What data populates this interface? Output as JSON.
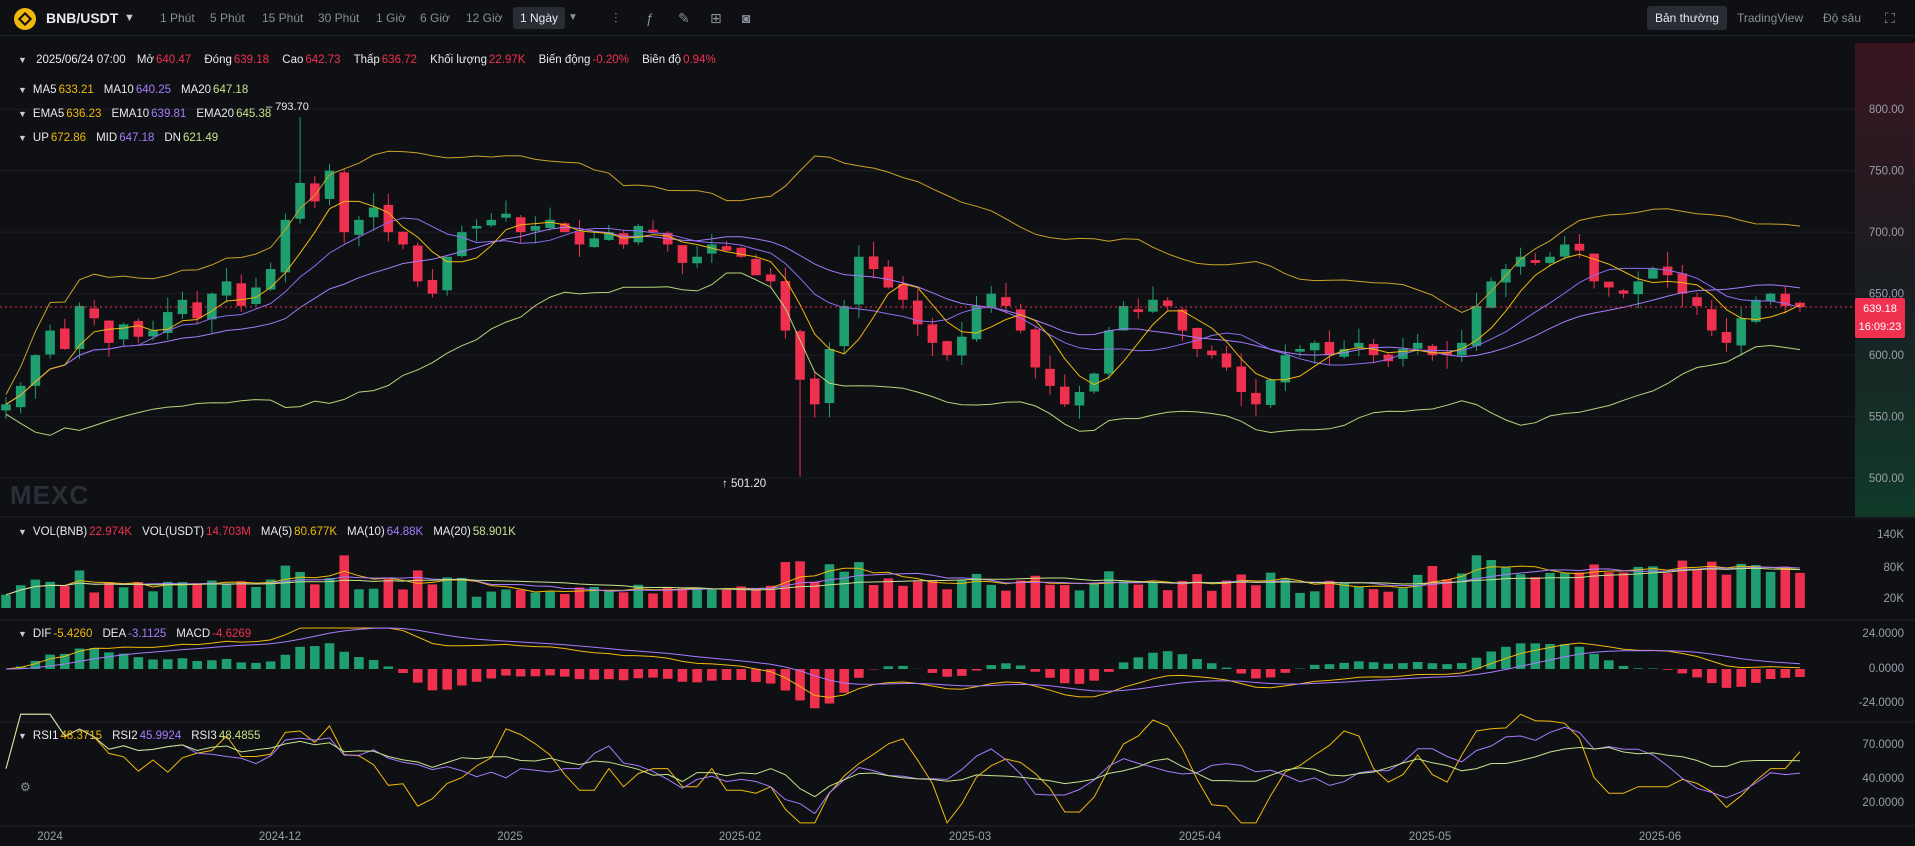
{
  "app": {
    "pair": "BNB/USDT",
    "intervals": [
      "1 Phút",
      "5 Phút",
      "15 Phút",
      "30 Phút",
      "1 Giờ",
      "6 Giờ",
      "12 Giờ",
      "1 Ngày"
    ],
    "active_interval": "1 Ngày",
    "view_modes": [
      "Bản thường",
      "TradingView",
      "Độ sâu"
    ],
    "active_view": "Bản thường",
    "watermark": "MEXC"
  },
  "ohlc": {
    "date": "2025/06/24 07:00",
    "open_label": "Mở",
    "open": "640.47",
    "close_label": "Đóng",
    "close": "639.18",
    "high_label": "Cao",
    "high": "642.73",
    "low_label": "Thấp",
    "low": "636.72",
    "volume_label": "Khối lượng",
    "volume": "22.97K",
    "change_label": "Biến động",
    "change": "-0.20%",
    "amp_label": "Biên độ",
    "amp": "0.94%"
  },
  "ma": [
    {
      "label": "MA5",
      "value": "633.21",
      "color": "#f0b90b"
    },
    {
      "label": "MA10",
      "value": "640.25",
      "color": "#a77bff"
    },
    {
      "label": "MA20",
      "value": "647.18",
      "color": "#c6e48b"
    }
  ],
  "ema": [
    {
      "label": "EMA5",
      "value": "636.23",
      "color": "#f0b90b"
    },
    {
      "label": "EMA10",
      "value": "639.81",
      "color": "#a77bff"
    },
    {
      "label": "EMA20",
      "value": "645.38",
      "color": "#c6e48b"
    }
  ],
  "boll": [
    {
      "label": "UP",
      "value": "672.86",
      "color": "#f0b90b"
    },
    {
      "label": "MID",
      "value": "647.18",
      "color": "#a77bff"
    },
    {
      "label": "DN",
      "value": "621.49",
      "color": "#c6e48b"
    }
  ],
  "vol_legend": [
    {
      "label": "VOL(BNB)",
      "value": "22.974K",
      "color": "#f0304f"
    },
    {
      "label": "VOL(USDT)",
      "value": "14.703M",
      "color": "#f0304f"
    },
    {
      "label": "MA(5)",
      "value": "80.677K",
      "color": "#f0b90b"
    },
    {
      "label": "MA(10)",
      "value": "64.88K",
      "color": "#a77bff"
    },
    {
      "label": "MA(20)",
      "value": "58.901K",
      "color": "#c6e48b"
    }
  ],
  "macd_legend": [
    {
      "label": "DIF",
      "value": "-5.4260",
      "color": "#f0b90b"
    },
    {
      "label": "DEA",
      "value": "-3.1125",
      "color": "#a77bff"
    },
    {
      "label": "MACD",
      "value": "-4.6269",
      "color": "#f0304f"
    }
  ],
  "rsi_legend": [
    {
      "label": "RSI1",
      "value": "48.3715",
      "color": "#f0b90b"
    },
    {
      "label": "RSI2",
      "value": "45.9924",
      "color": "#a77bff"
    },
    {
      "label": "RSI3",
      "value": "48.4855",
      "color": "#c6e48b"
    }
  ],
  "annotations": {
    "high": "793.70",
    "low": "501.20"
  },
  "last_price": {
    "price": "639.18",
    "countdown": "16:09:23"
  },
  "colors": {
    "up": "#1f9e6f",
    "down": "#f0304f",
    "bg": "#0f1014",
    "grid": "#1c1e24"
  },
  "chart_data": {
    "type": "candlestick",
    "title": "",
    "x_ticks": [
      "2024",
      "2024-12",
      "2025",
      "2025-02",
      "2025-03",
      "2025-04",
      "2025-05",
      "2025-06"
    ],
    "price_axis": {
      "ticks": [
        "800.00",
        "750.00",
        "700.00",
        "650.00",
        "600.00",
        "550.00",
        "500.00"
      ],
      "ylim": [
        470,
        840
      ]
    },
    "volume_axis": {
      "ticks": [
        "140K",
        "80K",
        "20K"
      ]
    },
    "macd_axis": {
      "ticks": [
        "24.0000",
        "0.0000",
        "-24.0000"
      ]
    },
    "rsi_axis": {
      "ticks": [
        "70.0000",
        "40.0000",
        "20.0000"
      ]
    },
    "close_path": [
      560,
      575,
      600,
      620,
      605,
      640,
      630,
      610,
      625,
      615,
      620,
      635,
      645,
      630,
      650,
      660,
      640,
      655,
      670,
      710,
      740,
      725,
      750,
      700,
      710,
      720,
      700,
      690,
      660,
      650,
      680,
      700,
      705,
      710,
      715,
      700,
      705,
      710,
      700,
      690,
      695,
      700,
      690,
      705,
      700,
      690,
      675,
      680,
      690,
      685,
      680,
      665,
      660,
      620,
      580,
      560,
      605,
      640,
      680,
      670,
      655,
      645,
      625,
      610,
      600,
      615,
      640,
      650,
      640,
      620,
      590,
      575,
      560,
      570,
      585,
      620,
      640,
      635,
      645,
      640,
      620,
      605,
      600,
      590,
      570,
      560,
      580,
      600,
      605,
      610,
      600,
      605,
      610,
      600,
      595,
      605,
      610,
      600,
      600,
      610,
      640,
      660,
      670,
      680,
      675,
      680,
      690,
      685,
      660,
      655,
      650,
      660,
      670,
      665,
      650,
      640,
      620,
      610,
      630,
      645,
      650,
      640,
      639
    ]
  }
}
